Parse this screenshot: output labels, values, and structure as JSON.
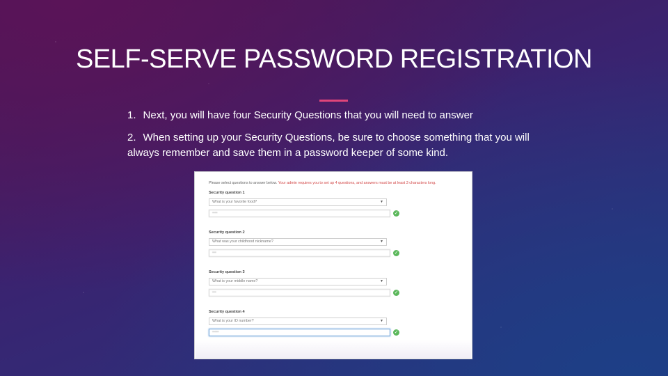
{
  "title": "SELF-SERVE PASSWORD REGISTRATION",
  "colors": {
    "accent": "#e0457a",
    "check": "#5cb85c",
    "warning_text": "#d24747"
  },
  "steps": [
    {
      "num": "1.",
      "text": "Next, you will have four Security Questions that you will need to answer"
    },
    {
      "num": "2.",
      "text": "When setting up your Security Questions, be sure to choose something that you will always remember and save them in a password keeper of some kind."
    }
  ],
  "panel": {
    "intro": "Please select questions to answer below.",
    "intro_warning": "Your admin requires you to set up 4 questions, and answers must be at least 3 characters long.",
    "questions": [
      {
        "label": "Security question 1",
        "selected": "What is your favorite food?",
        "answer": "••••"
      },
      {
        "label": "Security question 2",
        "selected": "What was your childhood nickname?",
        "answer": "•••"
      },
      {
        "label": "Security question 3",
        "selected": "What is your middle name?",
        "answer": "•••"
      },
      {
        "label": "Security question 4",
        "selected": "What is your ID number?",
        "answer": "•••••"
      }
    ],
    "dropdown_icon": "chevron-down-icon",
    "valid_icon": "check-circle-icon"
  }
}
